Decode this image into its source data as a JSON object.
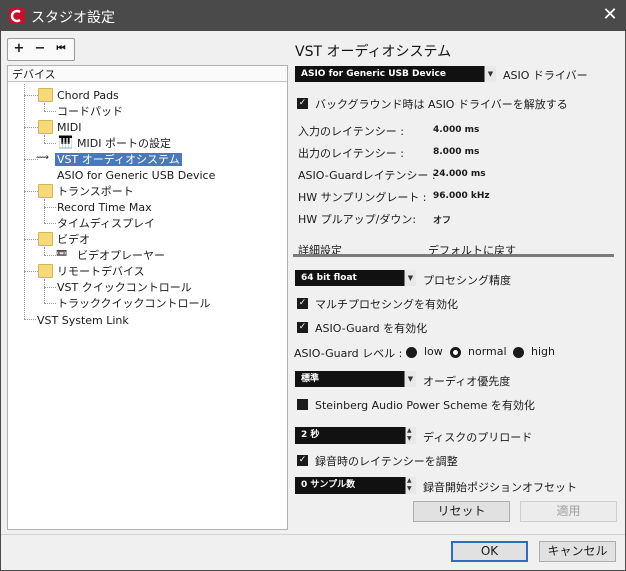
{
  "window": {
    "title": "スタジオ設定",
    "close_glyph": "✕"
  },
  "toolbar": {
    "add": "+",
    "remove": "−",
    "reset": "⏮"
  },
  "tree": {
    "header": "デバイス",
    "items": [
      {
        "label": "Chord Pads",
        "kind": "folder"
      },
      {
        "label": "コードパッド",
        "kind": "leaf"
      },
      {
        "label": "MIDI",
        "kind": "folder"
      },
      {
        "label": "MIDI ポートの設定",
        "kind": "midi"
      },
      {
        "label": "VST オーディオシステム",
        "kind": "selected"
      },
      {
        "label": "ASIO for Generic USB Device",
        "kind": "leaf"
      },
      {
        "label": "トランスポート",
        "kind": "folder"
      },
      {
        "label": "Record Time Max",
        "kind": "leaf"
      },
      {
        "label": "タイムディスプレイ",
        "kind": "leaf"
      },
      {
        "label": "ビデオ",
        "kind": "folder"
      },
      {
        "label": "ビデオプレーヤー",
        "kind": "video"
      },
      {
        "label": "リモートデバイス",
        "kind": "folder"
      },
      {
        "label": "VST クイックコントロール",
        "kind": "leaf"
      },
      {
        "label": "トラッククイックコントロール",
        "kind": "leaf"
      },
      {
        "label": "VST System Link",
        "kind": "leaf"
      }
    ]
  },
  "panel": {
    "title": "VST オーディオシステム",
    "driver_select": "ASIO for Generic USB Device",
    "driver_label": "ASIO ドライバー",
    "release_driver_label": "バックグラウンド時は ASIO ドライバーを解放する",
    "info": [
      {
        "label": "入力のレイテンシー :",
        "value": "4.000 ms"
      },
      {
        "label": "出力のレイテンシー :",
        "value": "8.000 ms"
      },
      {
        "label": "ASIO-Guardレイテンシー :",
        "value": "24.000 ms"
      },
      {
        "label": "HW サンプリングレート :",
        "value": "96.000 kHz"
      },
      {
        "label": "HW プルアップ/ダウン:",
        "value": "オフ"
      }
    ],
    "advanced_label": "詳細設定",
    "reset_defaults_label": "デフォルトに戻す",
    "precision_select": "64 bit float",
    "precision_label": "プロセシング精度",
    "multiproc_label": "マルチプロセシングを有効化",
    "asioguard_label": "ASIO-Guard を有効化",
    "asioguard_level_label": "ASIO-Guard レベル :",
    "levels": [
      "low",
      "normal",
      "high"
    ],
    "priority_select": "標準",
    "priority_label": "オーディオ優先度",
    "power_scheme_label": "Steinberg Audio Power Scheme を有効化",
    "preload_value": "2 秒",
    "preload_label": "ディスクのプリロード",
    "adjust_latency_label": "録音時のレイテンシーを調整",
    "offset_value": "0 サンプル数",
    "offset_label": "録音開始ポジションオフセット",
    "reset_button": "リセット",
    "apply_button": "適用"
  },
  "footer": {
    "ok": "OK",
    "cancel": "キャンセル"
  },
  "colors": {
    "titlebar": "#4a4a4a",
    "selection": "#4a78b8",
    "accent": "#c8102e"
  }
}
